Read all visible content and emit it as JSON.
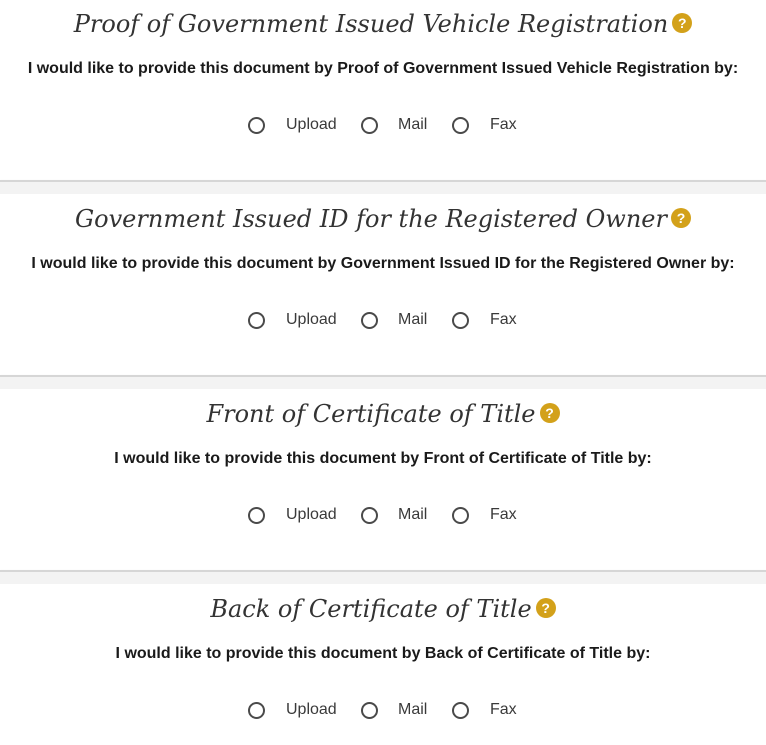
{
  "help_glyph": "?",
  "accent_color": "#d3a11a",
  "sections": [
    {
      "title": "Proof of Government Issued Vehicle Registration",
      "prompt": "I would like to provide this document by Proof of Government Issued Vehicle Registration by:",
      "options": [
        "Upload",
        "Mail",
        "Fax"
      ],
      "selected": null
    },
    {
      "title": "Government Issued ID for the Registered Owner",
      "prompt": "I would like to provide this document by Government Issued ID for the Registered Owner by:",
      "options": [
        "Upload",
        "Mail",
        "Fax"
      ],
      "selected": null
    },
    {
      "title": "Front of Certificate of Title",
      "prompt": "I would like to provide this document by Front of Certificate of Title by:",
      "options": [
        "Upload",
        "Mail",
        "Fax"
      ],
      "selected": null
    },
    {
      "title": "Back of Certificate of Title",
      "prompt": "I would like to provide this document by Back of Certificate of Title by:",
      "options": [
        "Upload",
        "Mail",
        "Fax"
      ],
      "selected": null
    }
  ]
}
